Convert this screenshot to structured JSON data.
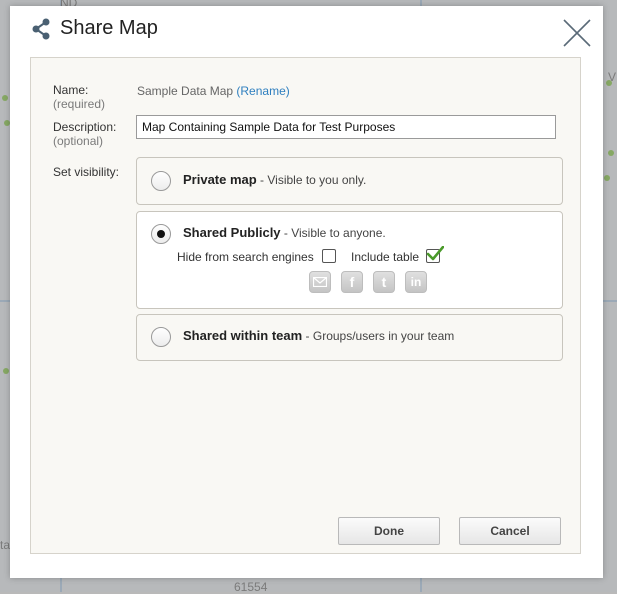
{
  "background": {
    "map_label_bottom": "61554",
    "map_label_top": "ND",
    "map_label_left": "ta",
    "map_label_right": "V"
  },
  "dialog": {
    "title": "Share Map",
    "icons": {
      "share": "share-icon",
      "close": "close-icon"
    }
  },
  "form": {
    "name_label": "Name:",
    "name_sub": "(required)",
    "name_value": "Sample Data Map",
    "rename_link": "(Rename)",
    "description_label": "Description:",
    "description_sub": "(optional)",
    "description_value": "Map Containing Sample Data for Test Purposes",
    "visibility_label": "Set visibility:"
  },
  "visibility_options": [
    {
      "title": "Private map",
      "desc": " - Visible to you only.",
      "selected": false
    },
    {
      "title": "Shared Publicly",
      "desc": " - Visible to anyone.",
      "selected": true
    },
    {
      "title": "Shared within team",
      "desc": " - Groups/users in your team",
      "selected": false
    }
  ],
  "public_options": {
    "hide_search_label": "Hide from search engines",
    "hide_search_checked": false,
    "include_table_label": "Include table",
    "include_table_checked": true,
    "social_icons": [
      "email-icon",
      "facebook-icon",
      "twitter-icon",
      "linkedin-icon"
    ]
  },
  "buttons": {
    "done": "Done",
    "cancel": "Cancel"
  },
  "colors": {
    "link": "#2f7fbf",
    "check": "#4a9a2a",
    "panel_bg": "#f9f8f4"
  }
}
